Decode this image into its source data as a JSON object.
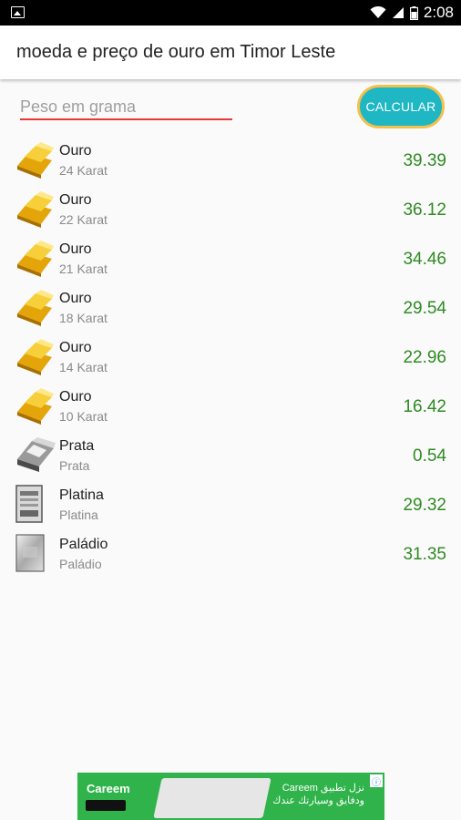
{
  "status_bar": {
    "time": "2:08"
  },
  "app_bar": {
    "title": "moeda e preço de ouro em Timor Leste"
  },
  "input": {
    "placeholder": "Peso em grama",
    "value": ""
  },
  "calculate_button": {
    "label": "CALCULAR"
  },
  "metals": [
    {
      "name": "Ouro",
      "detail": "24 Karat",
      "price": "39.39",
      "icon": "gold-bars-icon"
    },
    {
      "name": "Ouro",
      "detail": "22 Karat",
      "price": "36.12",
      "icon": "gold-bars-icon"
    },
    {
      "name": "Ouro",
      "detail": "21 Karat",
      "price": "34.46",
      "icon": "gold-bars-icon"
    },
    {
      "name": "Ouro",
      "detail": "18 Karat",
      "price": "29.54",
      "icon": "gold-bars-icon"
    },
    {
      "name": "Ouro",
      "detail": "14 Karat",
      "price": "22.96",
      "icon": "gold-bars-icon"
    },
    {
      "name": "Ouro",
      "detail": "10 Karat",
      "price": "16.42",
      "icon": "gold-bars-icon"
    },
    {
      "name": "Prata",
      "detail": "Prata",
      "price": "0.54",
      "icon": "silver-bars-icon"
    },
    {
      "name": "Platina",
      "detail": "Platina",
      "price": "29.32",
      "icon": "platinum-bar-icon"
    },
    {
      "name": "Paládio",
      "detail": "Paládio",
      "price": "31.35",
      "icon": "palladium-bar-icon"
    }
  ],
  "ad": {
    "brand": "Careem",
    "promo_line1": "نزل تطبيق Careem",
    "promo_line2": "ودفايق وسيارتك عندك",
    "close_icon": "ad-choices-icon"
  },
  "colors": {
    "accent_button": "#1fb7c4",
    "button_border": "#f2c14e",
    "input_underline": "#e53935",
    "price_text": "#2e8b22",
    "ad_background": "#2fb34a"
  }
}
